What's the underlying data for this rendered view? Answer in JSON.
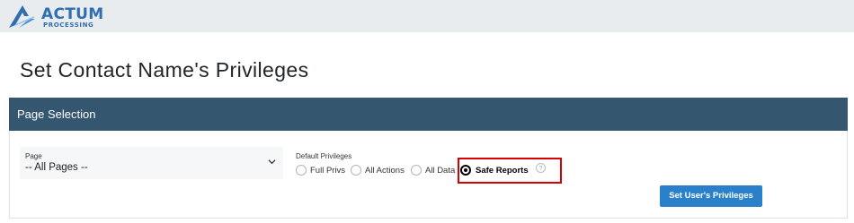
{
  "brand": {
    "name": "ACTUM",
    "subtitle": "PROCESSING",
    "color": "#2f6fb0"
  },
  "page": {
    "title": "Set Contact Name's Privileges"
  },
  "card": {
    "header": "Page Selection",
    "header_color": "#34566f"
  },
  "page_select": {
    "label": "Page",
    "value": "-- All Pages --"
  },
  "default_privileges": {
    "label": "Default Privileges",
    "options": [
      {
        "label": "Full Privs",
        "checked": false
      },
      {
        "label": "All Actions",
        "checked": false
      },
      {
        "label": "All Data",
        "checked": false
      },
      {
        "label": "Safe Reports",
        "checked": true
      }
    ],
    "help_symbol": "?"
  },
  "actions": {
    "submit_label": "Set User's Privileges",
    "submit_color": "#2a80c9"
  },
  "highlight_color": "#d60000"
}
